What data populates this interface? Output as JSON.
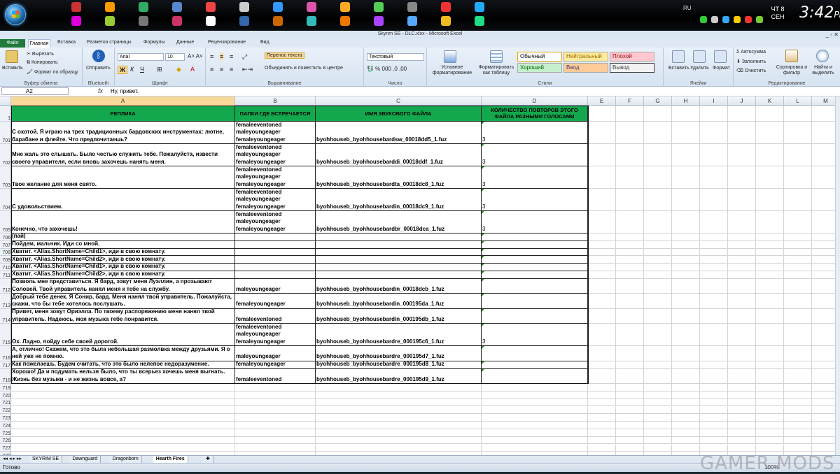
{
  "taskbar": {
    "lang": "RU",
    "day": "ЧТ",
    "date_num": "8",
    "month": "СЕН",
    "time": "3:42",
    "ampm": "PM"
  },
  "window": {
    "title": "Skyrim SE - DLC.xlsx - Microsoft Excel"
  },
  "ribbon": {
    "tabs": {
      "file": "Файл",
      "home": "Главная",
      "insert": "Вставка",
      "page_layout": "Разметка страницы",
      "formulas": "Формулы",
      "data": "Данные",
      "review": "Рецензирование",
      "view": "Вид"
    },
    "clipboard": {
      "paste": "Вставить",
      "cut": "Вырезать",
      "copy": "Копировать",
      "format_painter": "Формат по образцу",
      "label": "Буфер обмена"
    },
    "bluetooth": {
      "send": "Отправить",
      "label": "Bluetooth"
    },
    "font": {
      "name": "Arial",
      "size": "10",
      "label": "Шрифт",
      "bold": "Ж",
      "italic": "К",
      "underline": "Ч"
    },
    "alignment": {
      "wrap": "Перенос текста",
      "merge": "Объединить и поместить в центре",
      "label": "Выравнивание"
    },
    "number": {
      "format": "Текстовый",
      "label": "Число"
    },
    "styles": {
      "cond": "Условное форматирование",
      "as_table": "Форматировать как таблицу",
      "label": "Стили",
      "normal": "Обычный",
      "neutral": "Нейтральный",
      "bad": "Плохой",
      "good": "Хороший",
      "input": "Ввод",
      "output": "Вывод"
    },
    "cells": {
      "insert": "Вставить",
      "delete": "Удалить",
      "format": "Формат",
      "label": "Ячейки"
    },
    "editing": {
      "autosum": "Автосумма",
      "fill": "Заполнить",
      "clear": "Очистить",
      "sort": "Сортировка и фильтр",
      "find": "Найти и выделить",
      "label": "Редактирование"
    }
  },
  "formula_bar": {
    "name_box": "A2",
    "fx": "fx",
    "content": "Ну, привет."
  },
  "columns": [
    "A",
    "B",
    "C",
    "D",
    "E",
    "F",
    "G",
    "H",
    "I",
    "J",
    "K",
    "L",
    "M"
  ],
  "header_row": {
    "row": "1",
    "a": "РЕПЛИКА",
    "b": "ПАПКИ ГДЕ ВСТРЕЧАЕТСЯ",
    "c": "ИМЯ ЗВУКОВОГО ФАЙЛА",
    "d": "КОЛИЧЕСТВО ПОВТОРОВ ЭТОГО ФАЙЛА РАЗНЫМИ ГОЛОСАМИ"
  },
  "rows": [
    {
      "n": "701",
      "a": "С охотой. Я играю на трех традиционных бардовских инструментах: лютне, барабане и флейте. Что предпочитаешь?",
      "b": "femaleeventoned\nmaleyoungeager\nfemaleyoungeager",
      "c": "byohhouseb_byohhousebardsw_00018dd5_1.fuz",
      "d": "3"
    },
    {
      "n": "702",
      "a": "Мне жаль это слышать. Было честью служить тебе. Пожалуйста, извести своего управителя, если вновь захочешь нанять меня.",
      "b": "femaleeventoned\nmaleyoungeager\nfemaleyoungeager",
      "c": "byohhouseb_byohhousebarddі_00018ddf_1.fuz",
      "d": "3"
    },
    {
      "n": "703",
      "a": "Твое желание для меня свято.",
      "b": "femaleeventoned\nmaleyoungeager\nfemaleyoungeager",
      "c": "byohhouseb_byohhousebardta_00018dc8_1.fuz",
      "d": "3"
    },
    {
      "n": "704",
      "a": "С удовольствием.",
      "b": "femaleeventoned\nmaleyoungeager\nfemaleyoungeager",
      "c": "byohhouseb_byohhousebardin_00018dc9_1.fuz",
      "d": "3"
    },
    {
      "n": "705",
      "a": "Конечно, что захочешь!",
      "b": "femaleeventoned\nmaleyoungeager\nfemaleyoungeager",
      "c": "byohhouseb_byohhousebardbr_00018dca_1.fuz",
      "d": "3"
    },
    {
      "n": "706",
      "a": "(пай)",
      "b": "",
      "c": "",
      "d": ""
    },
    {
      "n": "707",
      "a": "Пойдем, мальчик. Иди со мной.",
      "b": "",
      "c": "",
      "d": ""
    },
    {
      "n": "708",
      "a": "Хватит. <Alias.ShortName=Child1>, иди в свою комнату.",
      "b": "",
      "c": "",
      "d": ""
    },
    {
      "n": "709",
      "a": "Хватит. <Alias.ShortName=Child2>, иди в свою комнату.",
      "b": "",
      "c": "",
      "d": ""
    },
    {
      "n": "710",
      "a": "Хватит. <Alias.ShortName=Child1>, иди в свою комнату.",
      "b": "",
      "c": "",
      "d": ""
    },
    {
      "n": "711",
      "a": "Хватит. <Alias.ShortName=Child2>, иди в свою комнату.",
      "b": "",
      "c": "",
      "d": ""
    },
    {
      "n": "712",
      "a": "Позволь мне представиться. Я бард, зовут меня Луэллин, а прозывают Соловей. Твой управитель нанял меня к тебе на службу.",
      "b": "maleyoungeager",
      "c": "byohhouseb_byohhousebardin_00018dcb_1.fuz",
      "d": ""
    },
    {
      "n": "713",
      "a": "Добрый тебе денек. Я Сонир, бард. Меня нанял твой управитель. Пожалуйста, скажи, что бы тебе хотелось послушать.",
      "b": "femaleyoungeager",
      "c": "byohhouseb_byohhousebardin_000195da_1.fuz",
      "d": ""
    },
    {
      "n": "714",
      "a": "Привет, меня зовут Ориэлла. По твоему распоряжению меня нанял твой управитель. Надеюсь, моя музыка тебе понравится.",
      "b": "femaleeventoned",
      "c": "byohhouseb_byohhousebardin_000195db_1.fuz",
      "d": ""
    },
    {
      "n": "715",
      "a": "Ох. Ладно, пойду себе своей дорогой.",
      "b": "femaleeventoned\nmaleyoungeager\nfemaleyoungeager",
      "c": "byohhouseb_byohhousebardre_000195c6_1.fuz",
      "d": "3"
    },
    {
      "n": "716",
      "a": "А, отлично! Скажем, что это была небольшая размолвка между друзьями. Я о ней уже не помню.",
      "b": "maleyoungeager",
      "c": "byohhouseb_byohhousebardre_000195d7_1.fuz",
      "d": ""
    },
    {
      "n": "717",
      "a": "Как пожелаешь. Будем считать, что это было нелепое недоразумение.",
      "b": "femaleyoungeager",
      "c": "byohhouseb_byohhousebardre_000195d8_1.fuz",
      "d": ""
    },
    {
      "n": "718",
      "a": "Хорошо! Да и подумать нельзя было, что ты всерьез хочешь меня выгнать. Жизнь без музыки - и не жизнь вовсе, а?",
      "b": "femaleeventoned",
      "c": "byohhouseb_byohhousebardre_000195d9_1.fuz",
      "d": ""
    }
  ],
  "empty_rows": [
    "719",
    "720",
    "721",
    "722",
    "723",
    "724",
    "725",
    "726",
    "727",
    "728",
    "729"
  ],
  "sheet_tabs": [
    "SKYRIM SE",
    "Dawnguard",
    "Dragonborn",
    "Hearth Fires"
  ],
  "active_sheet": "Hearth Fires",
  "status": {
    "ready": "Готово",
    "zoom": "100%"
  },
  "watermark": "GAMER MODS"
}
